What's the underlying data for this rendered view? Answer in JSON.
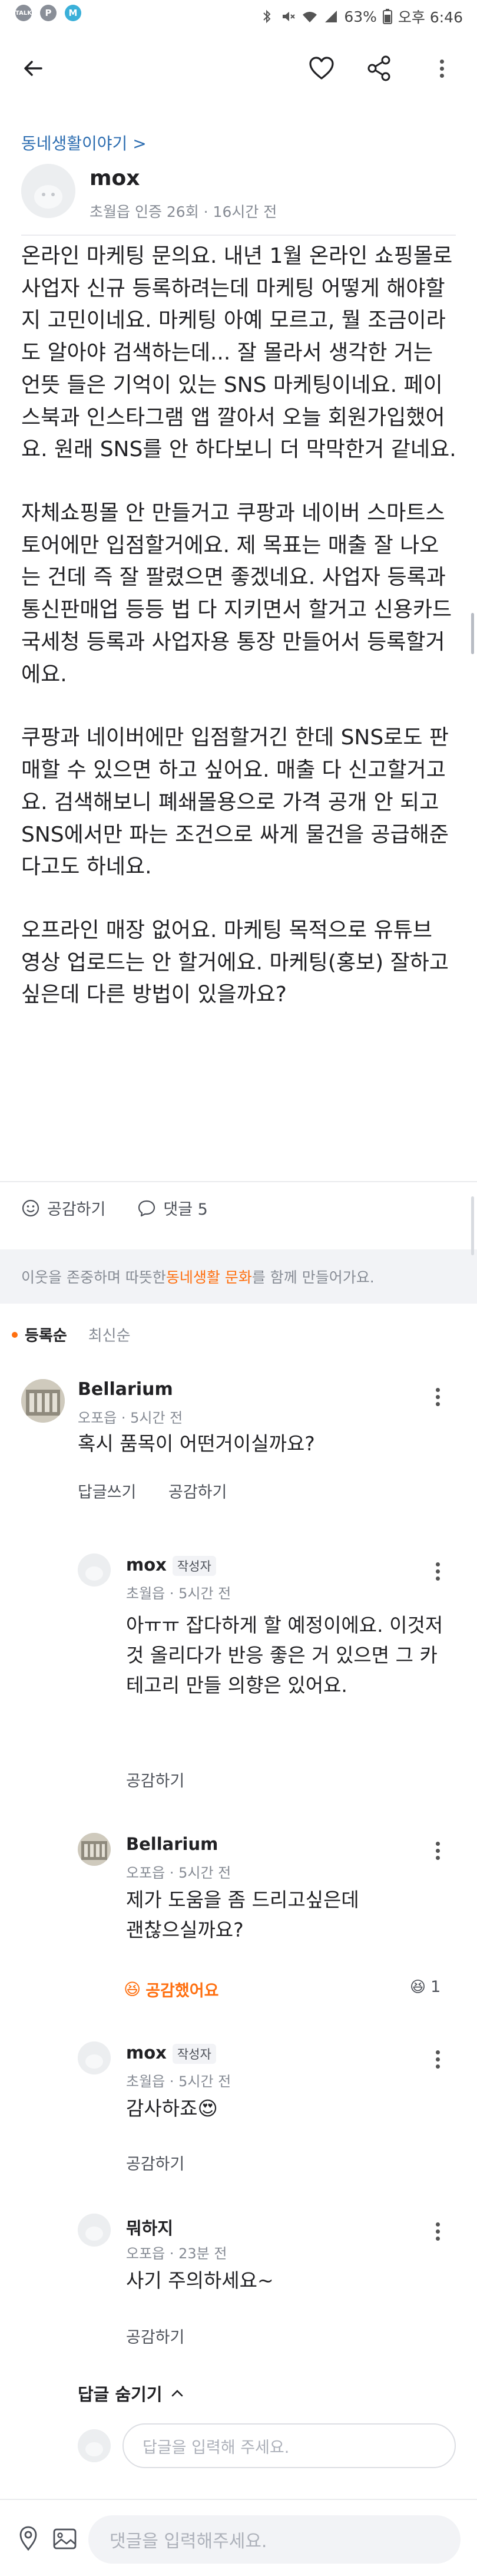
{
  "status_bar": {
    "app_icons": [
      {
        "name": "kakao-talk-icon",
        "label": "TALK",
        "color": "#8a8f98"
      },
      {
        "name": "kakao-p-icon",
        "label": "P",
        "color": "#8a8f98"
      },
      {
        "name": "notification-m-icon",
        "label": "M",
        "color": "#3bb0d9"
      }
    ],
    "battery": "63%",
    "clock": "오후 6:46"
  },
  "post": {
    "category": "동네생활이야기 >",
    "author": {
      "name": "mox",
      "meta": "초월읍 인증 26회 · 16시간 전"
    },
    "paragraphs": [
      "온라인 마케팅 문의요. 내년 1월 온라인 쇼핑몰로 사업자 신규 등록하려는데 마케팅 어떻게 해야할지 고민이네요. 마케팅 아예 모르고, 뭘 조금이라도 알아야 검색하는데... 잘 몰라서 생각한 거는 언뜻 들은 기억이 있는 SNS 마케팅이네요. 페이스북과 인스타그램 앱 깔아서 오늘 회원가입했어요. 원래 SNS를 안 하다보니 더 막막한거 같네요.",
      "자체쇼핑몰 안 만들거고 쿠팡과 네이버 스마트스토어에만 입점할거에요. 제 목표는 매출 잘 나오는 건데 즉 잘 팔렸으면 좋겠네요. 사업자 등록과 통신판매업 등등 법 다 지키면서 할거고 신용카드 국세청 등록과 사업자용 통장 만들어서 등록할거에요.",
      "쿠팡과 네이버에만 입점할거긴 한데 SNS로도 판매할 수 있으면 하고 싶어요. 매출 다 신고할거고요. 검색해보니 폐쇄몰용으로 가격 공개 안 되고 SNS에서만 파는 조건으로 싸게 물건을 공급해준다고도 하네요.",
      "오프라인 매장 없어요. 마케팅 목적으로 유튜브 영상 업로드는 안 할거에요. 마케팅(홍보) 잘하고 싶은데 다른 방법이 있을까요?"
    ],
    "reactions": {
      "like_label": "공감하기",
      "comment_label": "댓글 5"
    }
  },
  "notice": {
    "prefix": "이웃을 존중하며 따뜻한 ",
    "link": "동네생활 문화",
    "suffix": "를 함께 만들어가요."
  },
  "sort": {
    "active": "등록순",
    "inactive": "최신순"
  },
  "comments": [
    {
      "name": "Bellarium",
      "meta": "오포읍 · 5시간 전",
      "text": "혹시 품목이 어떤거이실까요?",
      "reply_label": "답글쓰기",
      "like_label": "공감하기"
    }
  ],
  "replies": [
    {
      "name": "mox",
      "badge": "작성자",
      "meta": "초월읍 · 5시간 전",
      "text": "아ㅠㅠ 잡다하게 할 예정이에요. 이것저것 올리다가 반응 좋은 거 있으면 그 카테고리 만들 의향은 있어요.",
      "like_label": "공감하기"
    },
    {
      "name": "Bellarium",
      "meta": "오포읍 · 5시간 전",
      "text": "제가 도움을 좀 드리고싶은데 괜찮으실까요?",
      "like_label": "공감했어요",
      "like_count": "1"
    },
    {
      "name": "mox",
      "badge": "작성자",
      "meta": "초월읍 · 5시간 전",
      "text": "감사하죠😍",
      "like_label": "공감하기"
    },
    {
      "name": "뭐하지",
      "meta": "오포읍 · 23분 전",
      "text": "사기 주의하세요~",
      "like_label": "공감하기"
    }
  ],
  "hide_replies_label": "답글 숨기기",
  "reply_input_placeholder": "답글을 입력해 주세요.",
  "comment_input_placeholder": "댓글을 입력해주세요.",
  "colors": {
    "accent": "#ff6f0f",
    "link": "#2b6cb0"
  }
}
